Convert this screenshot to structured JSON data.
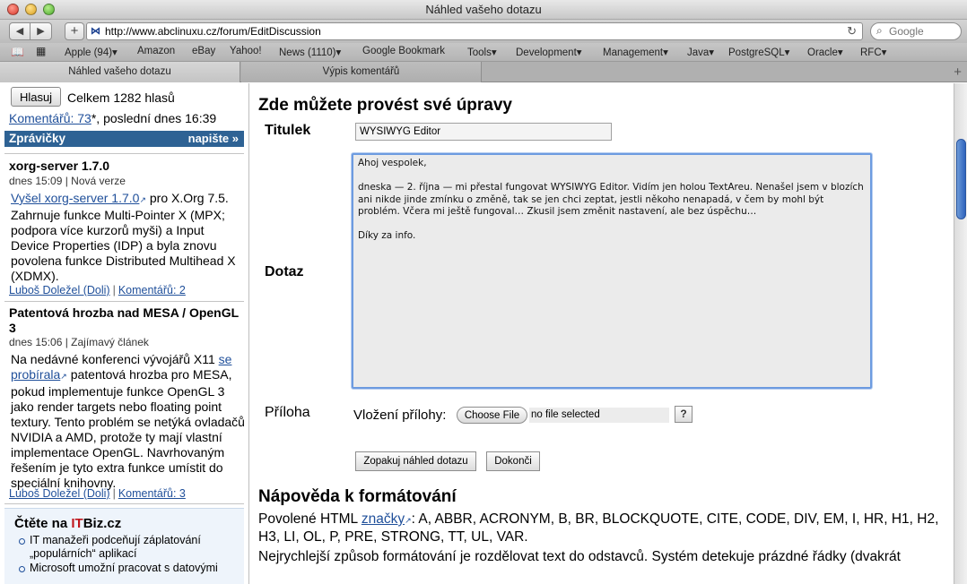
{
  "window": {
    "title": "Náhled vašeho dotazu"
  },
  "toolbar": {
    "back": "◀",
    "forward": "▶",
    "add": "+",
    "url": "http://www.abclinuxu.cz/forum/EditDiscussion",
    "search_placeholder": "Google"
  },
  "bookmarks": [
    "Apple (94)▾",
    "Amazon",
    "eBay",
    "Yahoo!",
    "News (1110)▾",
    "Google Bookmark",
    "Tools▾",
    "Development▾",
    "Management▾",
    "Java▾",
    "PostgreSQL▾",
    "Oracle▾",
    "RFC▾"
  ],
  "tabs": [
    {
      "label": "Náhled vašeho dotazu",
      "active": true
    },
    {
      "label": "Výpis komentářů",
      "active": false
    }
  ],
  "sidebar": {
    "vote_button": "Hlasuj",
    "vote_total": "Celkem 1282 hlasů",
    "comments_link": "Komentářů: 73",
    "comments_rest": "*, poslední dnes 16:39",
    "news_header": "Zprávičky",
    "news_write": "napište »",
    "news": [
      {
        "title": "xorg-server 1.7.0",
        "meta": "dnes 15:09 | Nová verze",
        "link": "Vyšel xorg-server 1.7.0",
        "body": " pro X.Org 7.5. Zahrnuje funkce Multi-Pointer X (MPX; podpora více kurzorů myši) a Input Device Properties (IDP) a byla znovu povolena funkce Distributed Multihead X (XDMX).",
        "author": "Luboš Doležel (Doli)",
        "comments": "Komentářů: 2"
      },
      {
        "title": "Patentová hrozba nad MESA / OpenGL 3",
        "meta": "dnes 15:06 | Zajímavý článek",
        "body_pre": "Na nedávné konferenci vývojářů X11 ",
        "link": "se probírala",
        "body": " patentová hrozba pro MESA, pokud implementuje funkce OpenGL 3 jako render targets nebo floating point textury. Tento problém se netýká ovladačů NVIDIA a AMD, protože ty mají vlastní implementace OpenGL. Navrhovaným řešením je tyto extra funkce umístit do speciální knihovny.",
        "author": "Luboš Doležel (Doli)",
        "comments": "Komentářů: 3"
      }
    ],
    "itbiz": {
      "title_pre": "Čtěte na ",
      "title_red": "IT",
      "title_post": "Biz.cz",
      "items": [
        "IT manažeři podceňují záplatování „populárních“ aplikací",
        "Microsoft umožní pracovat s datovými"
      ]
    }
  },
  "main": {
    "page_title": "Zde můžete provést své úpravy",
    "title_label": "Titulek",
    "title_value": "WYSIWYG Editor",
    "question_label": "Dotaz",
    "question_value": "Ahoj vespolek,\n\ndneska — 2. října — mi přestal fungovat WYSIWYG Editor. Vidím jen holou TextAreu. Nenašel jsem v blozích ani nikde jinde zmínku o změně, tak se jen chci zeptat, jestli někoho nenapadá, v čem by mohl být problém. Včera mi ještě fungoval… Zkusil jsem změnit nastavení, ale bez úspěchu…\n\nDíky za info.",
    "attach_label": "Příloha",
    "attach_inline_label": "Vložení přílohy:",
    "choose_file": "Choose File",
    "no_file": "no file selected",
    "help_btn": "?",
    "preview_btn": "Zopakuj náhled dotazu",
    "finish_btn": "Dokonči",
    "help_title": "Nápověda k formátování",
    "allowed_pre": "Povolené HTML ",
    "allowed_link": "značky",
    "allowed_post": ": A, ABBR, ACRONYM, B, BR, BLOCKQUOTE, CITE, CODE, DIV, EM, I, HR, H1, H2, H3, LI, OL, P, PRE, STRONG, TT, UL, VAR.",
    "recommend": "Nejrychlejší způsob formátování je rozdělovat text do odstavců. Systém detekuje prázdné řádky (dvakrát"
  }
}
